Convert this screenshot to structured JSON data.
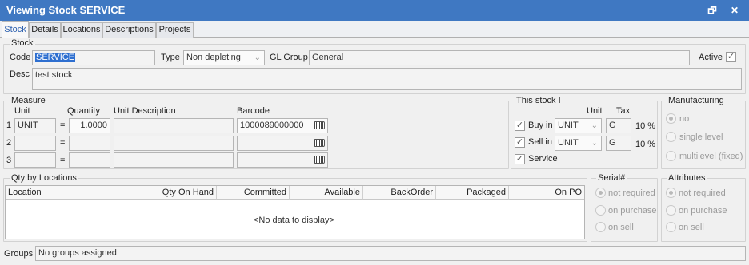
{
  "window": {
    "title": "Viewing Stock SERVICE",
    "restore_icon": "restore-icon",
    "close_icon": "close-icon",
    "restore_glyph": "🗗",
    "close_glyph": "✕"
  },
  "tabs": [
    {
      "label": "Stock",
      "active": true
    },
    {
      "label": "Details"
    },
    {
      "label": "Locations"
    },
    {
      "label": "Descriptions"
    },
    {
      "label": "Projects"
    }
  ],
  "stock": {
    "group_label": "Stock",
    "code_label": "Code",
    "code_value": "SERVICE",
    "type_label": "Type",
    "type_value": "Non depleting",
    "gl_label": "GL Group",
    "gl_value": "General",
    "active_label": "Active",
    "active_checked": true,
    "desc_label": "Desc",
    "desc_value": "test stock"
  },
  "measure": {
    "group_label": "Measure",
    "headers": {
      "unit": "Unit",
      "quantity": "Quantity",
      "unit_desc": "Unit Description",
      "barcode": "Barcode"
    },
    "rows": [
      {
        "num": "1",
        "unit": "UNIT",
        "eq": "=",
        "quantity": "1.0000",
        "unit_desc": "",
        "barcode": "1000089000000"
      },
      {
        "num": "2",
        "unit": "",
        "eq": "=",
        "quantity": "",
        "unit_desc": "",
        "barcode": ""
      },
      {
        "num": "3",
        "unit": "",
        "eq": "=",
        "quantity": "",
        "unit_desc": "",
        "barcode": ""
      }
    ]
  },
  "this_stock": {
    "group_label": "This stock I",
    "unit_header": "Unit",
    "tax_header": "Tax",
    "buy_label": "Buy in",
    "buy_unit": "UNIT",
    "buy_tax": "G",
    "buy_rate": "10 %",
    "sell_label": "Sell in",
    "sell_unit": "UNIT",
    "sell_tax": "G",
    "sell_rate": "10 %",
    "service_label": "Service"
  },
  "manufacturing": {
    "group_label": "Manufacturing",
    "options": [
      "no",
      "single level",
      "multilevel (fixed)"
    ]
  },
  "qty": {
    "group_label": "Qty by Locations",
    "columns": [
      "Location",
      "Qty On Hand",
      "Committed",
      "Available",
      "BackOrder",
      "Packaged",
      "On PO"
    ],
    "empty": "<No data to display>"
  },
  "serial": {
    "group_label": "Serial#",
    "options": [
      "not required",
      "on purchase",
      "on sell"
    ]
  },
  "attributes": {
    "group_label": "Attributes",
    "options": [
      "not required",
      "on purchase",
      "on sell"
    ]
  },
  "groups": {
    "label": "Groups",
    "value": "No groups assigned"
  },
  "colors": {
    "titlebar": "#3f78c2",
    "selection": "#2e6fd0",
    "active_tab": "#2b5fae"
  }
}
